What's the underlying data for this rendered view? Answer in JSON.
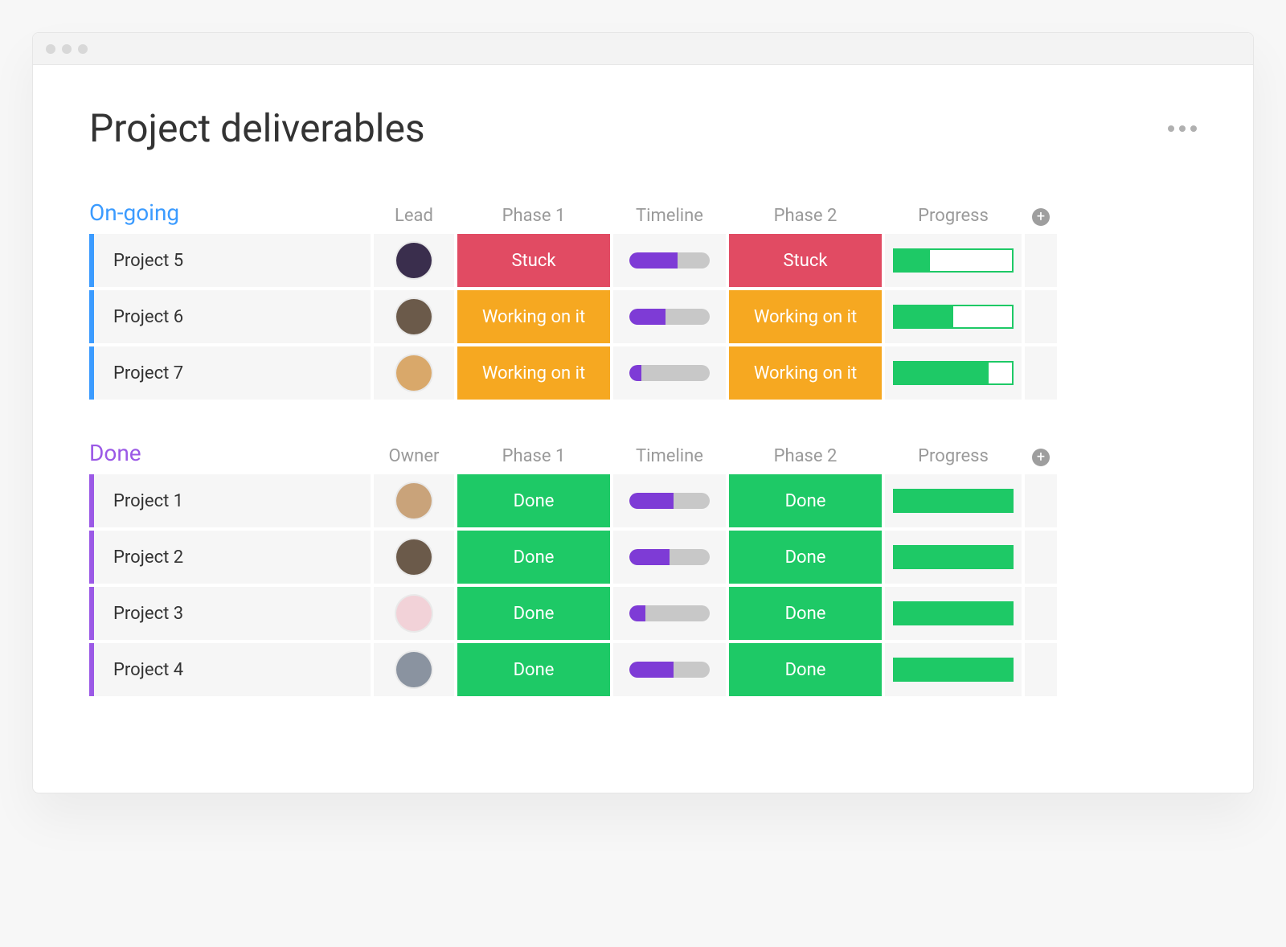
{
  "page_title": "Project deliverables",
  "colors": {
    "ongoing_group": "#3b9bff",
    "done_group": "#9b59e6",
    "stuck": "#e14b63",
    "working": "#f6a821",
    "done": "#1ec966",
    "timeline_fill": "#7e3bd6",
    "timeline_bg": "#c8c8c8",
    "progress_green": "#1ec966"
  },
  "groups": [
    {
      "id": "ongoing",
      "title": "On-going",
      "color_key": "ongoing_group",
      "columns": [
        "Lead",
        "Phase 1",
        "Timeline",
        "Phase 2",
        "Progress"
      ],
      "rows": [
        {
          "name": "Project 5",
          "avatar_bg": "#3a2e4d",
          "phase1": {
            "label": "Stuck",
            "color_key": "stuck"
          },
          "timeline_pct": 60,
          "phase2": {
            "label": "Stuck",
            "color_key": "stuck"
          },
          "progress_pct": 30
        },
        {
          "name": "Project 6",
          "avatar_bg": "#6b5a4a",
          "phase1": {
            "label": "Working on it",
            "color_key": "working"
          },
          "timeline_pct": 45,
          "phase2": {
            "label": "Working on it",
            "color_key": "working"
          },
          "progress_pct": 50
        },
        {
          "name": "Project 7",
          "avatar_bg": "#d9a86a",
          "phase1": {
            "label": "Working on it",
            "color_key": "working"
          },
          "timeline_pct": 15,
          "phase2": {
            "label": "Working on it",
            "color_key": "working"
          },
          "progress_pct": 80
        }
      ]
    },
    {
      "id": "done",
      "title": "Done",
      "color_key": "done_group",
      "columns": [
        "Owner",
        "Phase 1",
        "Timeline",
        "Phase 2",
        "Progress"
      ],
      "rows": [
        {
          "name": "Project 1",
          "avatar_bg": "#c9a37a",
          "phase1": {
            "label": "Done",
            "color_key": "done"
          },
          "timeline_pct": 55,
          "phase2": {
            "label": "Done",
            "color_key": "done"
          },
          "progress_pct": 100
        },
        {
          "name": "Project 2",
          "avatar_bg": "#6b5a4a",
          "phase1": {
            "label": "Done",
            "color_key": "done"
          },
          "timeline_pct": 50,
          "phase2": {
            "label": "Done",
            "color_key": "done"
          },
          "progress_pct": 100
        },
        {
          "name": "Project 3",
          "avatar_bg": "#f2d2d8",
          "phase1": {
            "label": "Done",
            "color_key": "done"
          },
          "timeline_pct": 20,
          "phase2": {
            "label": "Done",
            "color_key": "done"
          },
          "progress_pct": 100
        },
        {
          "name": "Project 4",
          "avatar_bg": "#8a93a0",
          "phase1": {
            "label": "Done",
            "color_key": "done"
          },
          "timeline_pct": 55,
          "phase2": {
            "label": "Done",
            "color_key": "done"
          },
          "progress_pct": 100
        }
      ]
    }
  ]
}
